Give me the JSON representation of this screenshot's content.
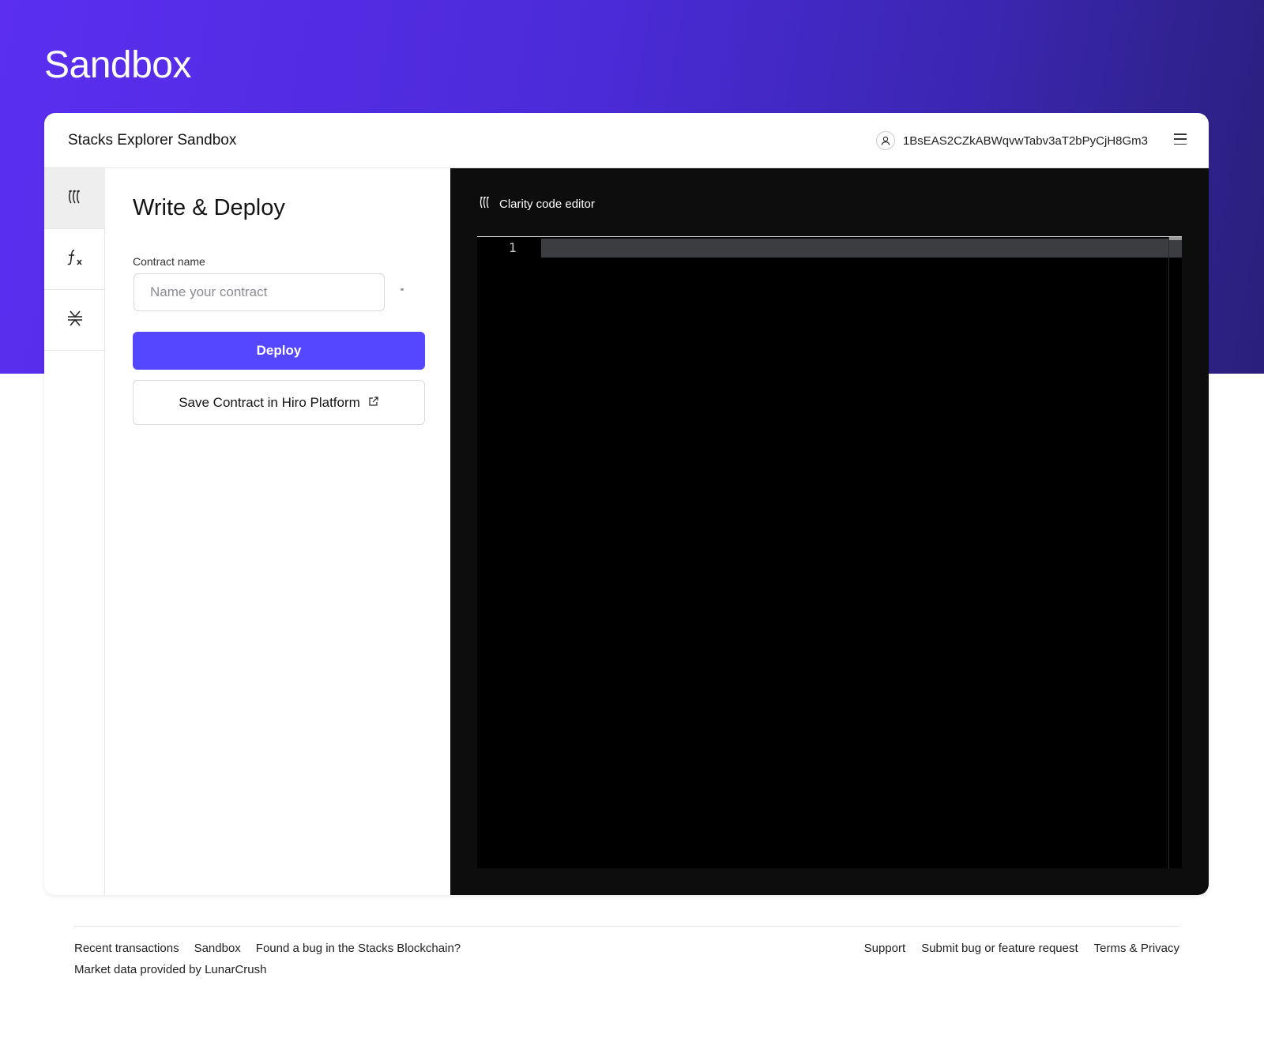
{
  "page": {
    "title": "Sandbox"
  },
  "card": {
    "title": "Stacks Explorer Sandbox",
    "account_address": "1BsEAS2CZkABWqvwTabv3aT2bPyCjH8Gm3"
  },
  "rail": {
    "items": [
      {
        "name": "clarity-icon",
        "active": true
      },
      {
        "name": "function-icon",
        "active": false
      },
      {
        "name": "stacks-icon",
        "active": false
      }
    ]
  },
  "panel": {
    "heading": "Write & Deploy",
    "contract_name_label": "Contract name",
    "contract_name_placeholder": "Name your contract",
    "contract_name_value": "",
    "deploy_label": "Deploy",
    "save_label": "Save Contract in Hiro Platform"
  },
  "editor": {
    "title": "Clarity code editor",
    "line_numbers": [
      "1"
    ]
  },
  "footer": {
    "left_links": [
      "Recent transactions",
      "Sandbox",
      "Found a bug in the Stacks Blockchain?"
    ],
    "right_links": [
      "Support",
      "Submit bug or feature request",
      "Terms & Privacy"
    ],
    "note": "Market data provided by LunarCrush"
  },
  "colors": {
    "accent": "#5546ff",
    "hero_gradient_start": "#5b2ef0",
    "hero_gradient_end": "#2a1f7a",
    "editor_bg": "#000000"
  }
}
